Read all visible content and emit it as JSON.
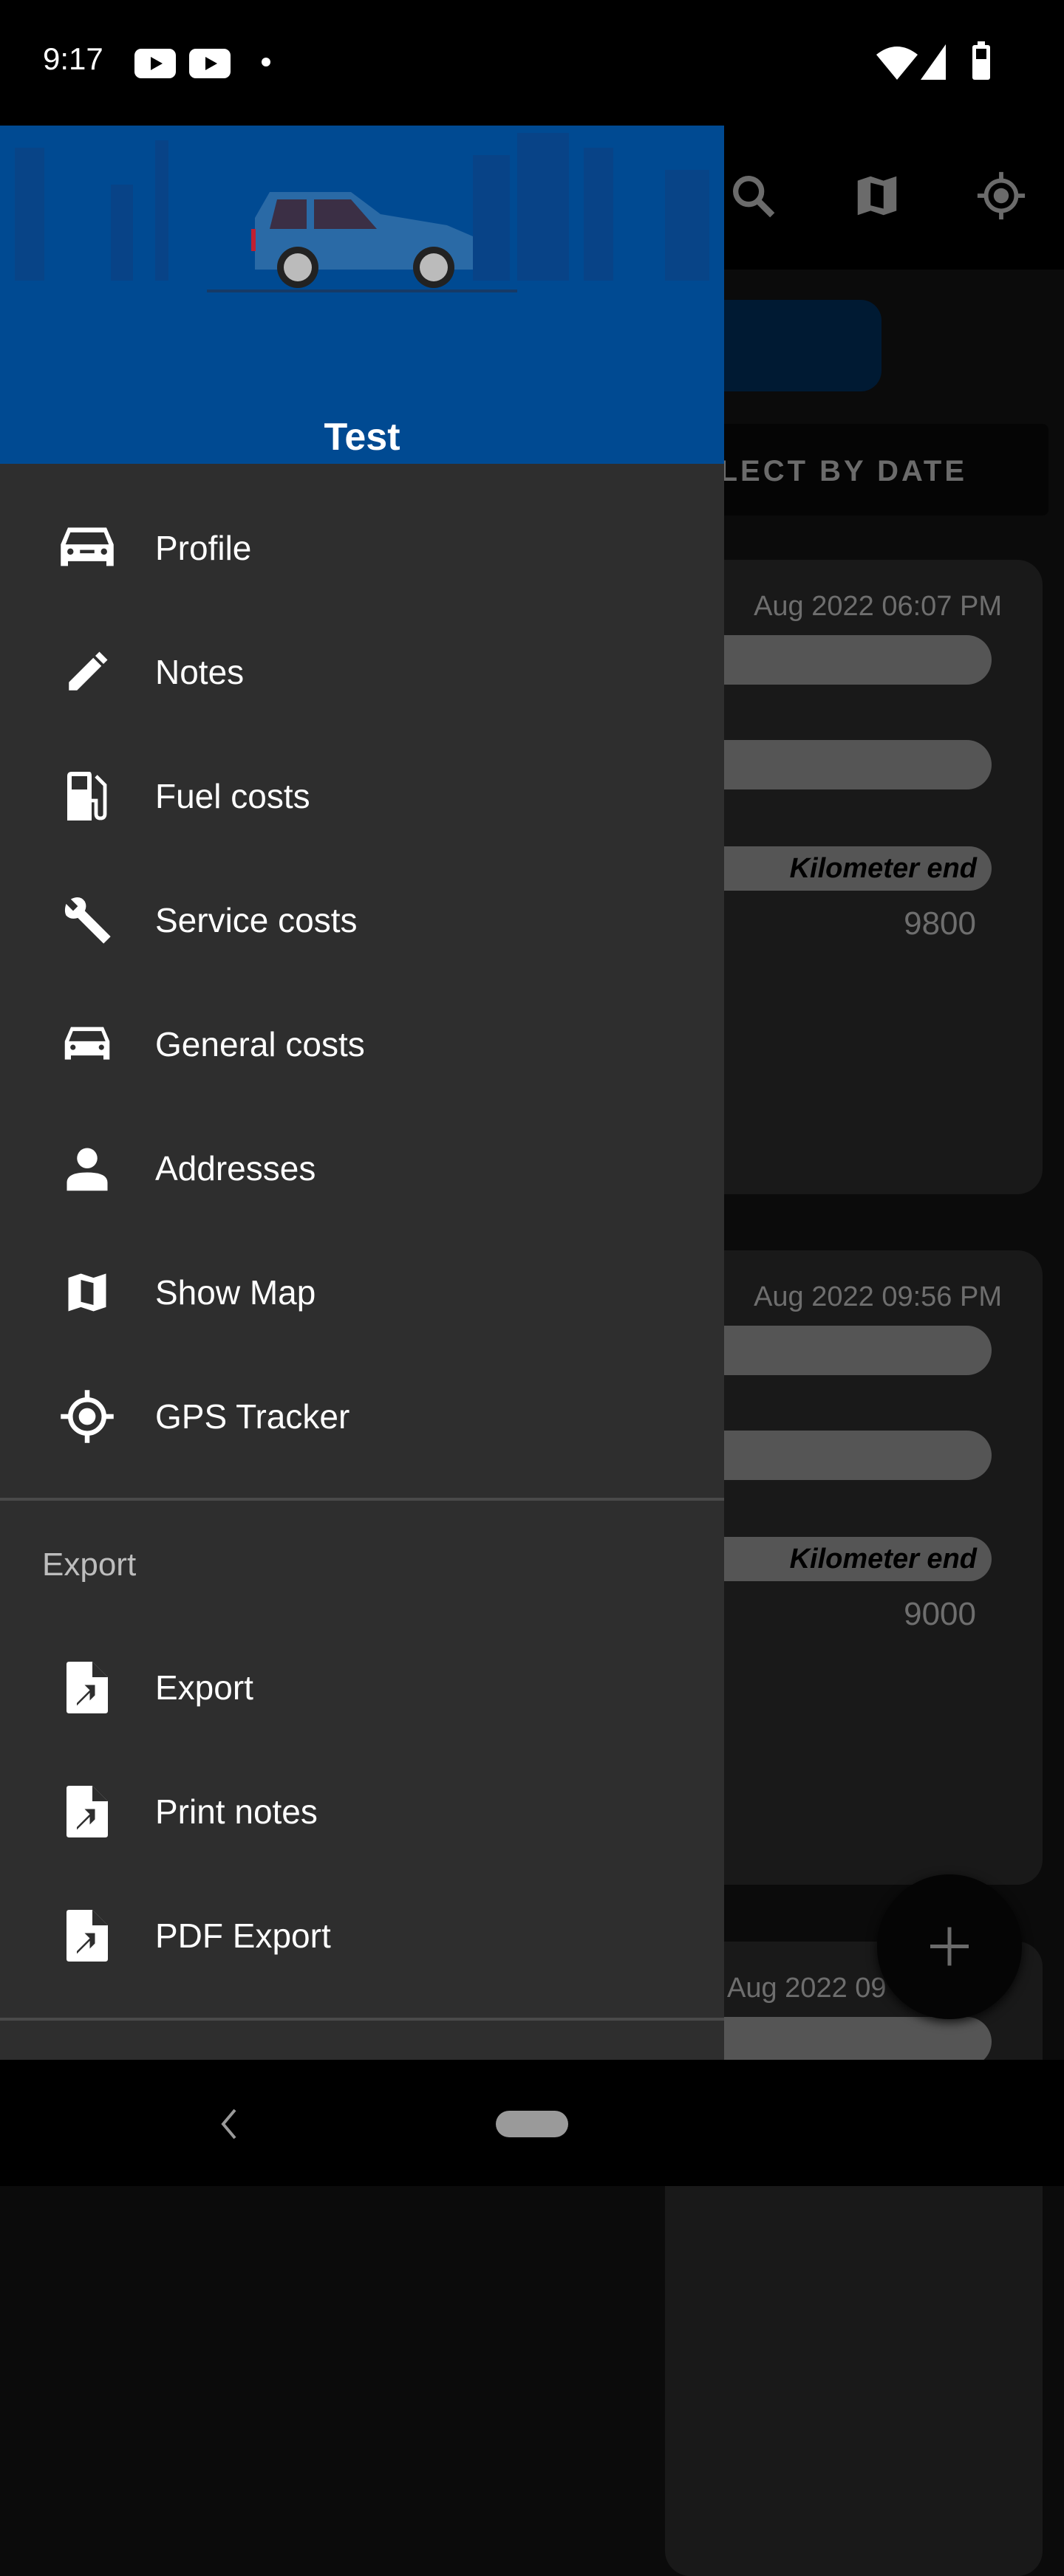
{
  "status_bar": {
    "time": "9:17",
    "icons": [
      "youtube-icon",
      "youtube-icon",
      "dot-icon",
      "wifi-icon",
      "signal-icon",
      "battery-icon"
    ]
  },
  "app_bar": {
    "actions": [
      "search-icon",
      "map-icon",
      "gps-icon"
    ]
  },
  "main": {
    "select_by_date": "SELECT BY DATE",
    "cards": [
      {
        "date": "Aug 2022 06:07 PM",
        "km_label": "Kilometer end",
        "km_value": "9800"
      },
      {
        "date": "Aug 2022 09:56 PM",
        "km_label": "Kilometer end",
        "km_value": "9000"
      },
      {
        "date": "Aug 2022 09"
      }
    ],
    "fab": "add-icon"
  },
  "drawer": {
    "user_name": "Test",
    "items": [
      {
        "label": "Profile",
        "icon": "car-icon"
      },
      {
        "label": "Notes",
        "icon": "pencil-icon"
      },
      {
        "label": "Fuel costs",
        "icon": "fuel-pump-icon"
      },
      {
        "label": "Service costs",
        "icon": "wrench-icon"
      },
      {
        "label": "General costs",
        "icon": "car-icon"
      },
      {
        "label": "Addresses",
        "icon": "person-icon"
      },
      {
        "label": "Show Map",
        "icon": "map-icon"
      },
      {
        "label": "GPS Tracker",
        "icon": "gps-icon"
      }
    ],
    "export_section": {
      "title": "Export",
      "items": [
        {
          "label": "Export",
          "icon": "file-export-icon"
        },
        {
          "label": "Print notes",
          "icon": "file-export-icon"
        },
        {
          "label": "PDF Export",
          "icon": "file-export-icon"
        }
      ]
    }
  },
  "colors": {
    "drawer_header": "#004a92",
    "drawer_bg": "#2e2e2e",
    "card_bg": "#191919"
  }
}
